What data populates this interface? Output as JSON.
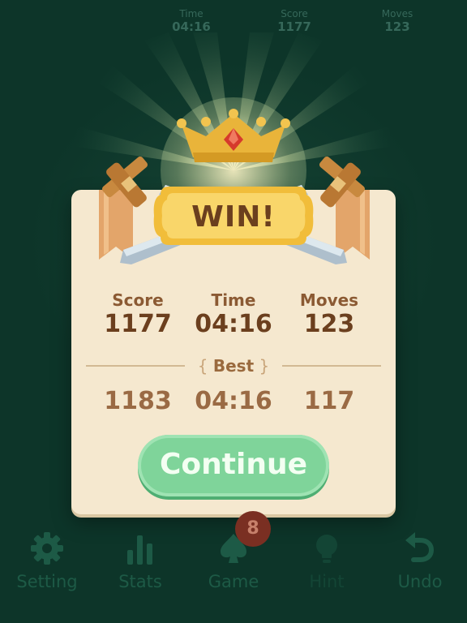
{
  "topbar": {
    "time_label": "Time",
    "time_value": "04:16",
    "score_label": "Score",
    "score_value": "1177",
    "moves_label": "Moves",
    "moves_value": "123"
  },
  "dialog": {
    "title": "WIN!",
    "current": {
      "score_label": "Score",
      "score_value": "1177",
      "time_label": "Time",
      "time_value": "04:16",
      "moves_label": "Moves",
      "moves_value": "123"
    },
    "best_label": "Best",
    "best": {
      "score": "1183",
      "time": "04:16",
      "moves": "117"
    },
    "continue_label": "Continue"
  },
  "toolbar": {
    "items": [
      {
        "label": "Setting",
        "icon": "gear-icon"
      },
      {
        "label": "Stats",
        "icon": "bar-chart-icon"
      },
      {
        "label": "Game",
        "icon": "spade-icon"
      },
      {
        "label": "Hint",
        "icon": "lightbulb-icon"
      },
      {
        "label": "Undo",
        "icon": "undo-arrow-icon"
      }
    ],
    "game_badge": "8"
  },
  "colors": {
    "background": "#0d3529",
    "card": "#f5e8cf",
    "button": "#7fd49a",
    "toolbar_text": "#1d5a46"
  }
}
